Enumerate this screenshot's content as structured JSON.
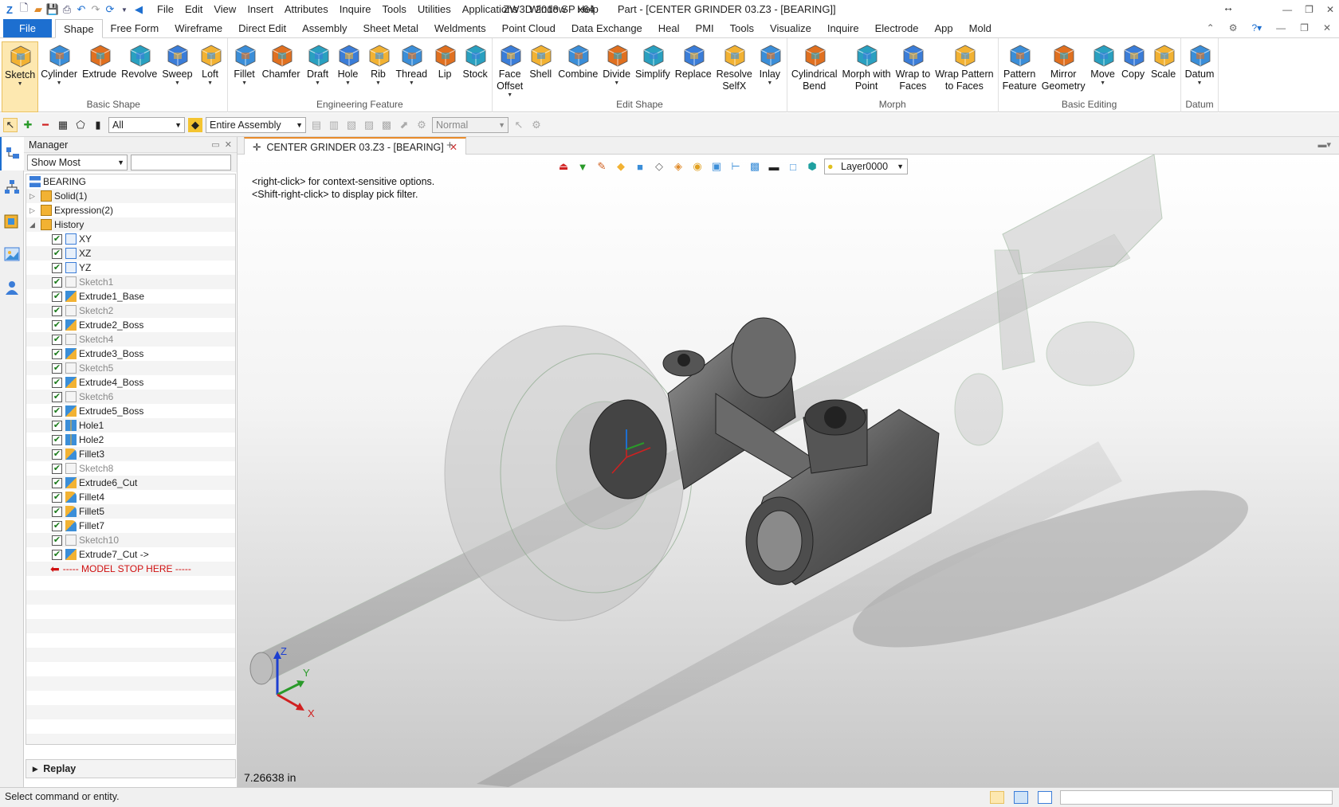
{
  "app": {
    "title": "ZW3D 2018 SP x64",
    "document_title": "Part - [CENTER GRINDER 03.Z3 - [BEARING]]"
  },
  "menubar": [
    "File",
    "Edit",
    "View",
    "Insert",
    "Attributes",
    "Inquire",
    "Tools",
    "Utilities",
    "Applications",
    "Window",
    "Help"
  ],
  "ribbon_tabs": [
    "File",
    "Shape",
    "Free Form",
    "Wireframe",
    "Direct Edit",
    "Assembly",
    "Sheet Metal",
    "Weldments",
    "Point Cloud",
    "Data Exchange",
    "Heal",
    "PMI",
    "Tools",
    "Visualize",
    "Inquire",
    "Electrode",
    "App",
    "Mold"
  ],
  "active_tab": "Shape",
  "ribbon_groups": [
    {
      "label": "Basic Shape",
      "buttons": [
        {
          "label": "Sketch",
          "icon": "sketch-icon",
          "dropdown": true,
          "selected": true
        },
        {
          "label": "Cylinder",
          "icon": "cylinder-icon",
          "dropdown": true
        },
        {
          "label": "Extrude",
          "icon": "extrude-icon"
        },
        {
          "label": "Revolve",
          "icon": "revolve-icon"
        },
        {
          "label": "Sweep",
          "icon": "sweep-icon",
          "dropdown": true
        },
        {
          "label": "Loft",
          "icon": "loft-icon",
          "dropdown": true
        }
      ]
    },
    {
      "label": "Engineering Feature",
      "buttons": [
        {
          "label": "Fillet",
          "icon": "fillet-icon",
          "dropdown": true
        },
        {
          "label": "Chamfer",
          "icon": "chamfer-icon"
        },
        {
          "label": "Draft",
          "icon": "draft-icon",
          "dropdown": true
        },
        {
          "label": "Hole",
          "icon": "hole-icon",
          "dropdown": true
        },
        {
          "label": "Rib",
          "icon": "rib-icon",
          "dropdown": true
        },
        {
          "label": "Thread",
          "icon": "thread-icon",
          "dropdown": true
        },
        {
          "label": "Lip",
          "icon": "lip-icon"
        },
        {
          "label": "Stock",
          "icon": "stock-icon"
        }
      ]
    },
    {
      "label": "Edit Shape",
      "buttons": [
        {
          "label": "Face\nOffset",
          "icon": "face-offset-icon",
          "dropdown": true
        },
        {
          "label": "Shell",
          "icon": "shell-icon"
        },
        {
          "label": "Combine",
          "icon": "combine-icon"
        },
        {
          "label": "Divide",
          "icon": "divide-icon",
          "dropdown": true
        },
        {
          "label": "Simplify",
          "icon": "simplify-icon"
        },
        {
          "label": "Replace",
          "icon": "replace-icon"
        },
        {
          "label": "Resolve\nSelfX",
          "icon": "resolve-selfx-icon"
        },
        {
          "label": "Inlay",
          "icon": "inlay-icon",
          "dropdown": true
        }
      ]
    },
    {
      "label": "Morph",
      "buttons": [
        {
          "label": "Cylindrical\nBend",
          "icon": "cylindrical-bend-icon"
        },
        {
          "label": "Morph with\nPoint",
          "icon": "morph-point-icon"
        },
        {
          "label": "Wrap to\nFaces",
          "icon": "wrap-faces-icon"
        },
        {
          "label": "Wrap Pattern\nto Faces",
          "icon": "wrap-pattern-icon"
        }
      ]
    },
    {
      "label": "Basic Editing",
      "buttons": [
        {
          "label": "Pattern\nFeature",
          "icon": "pattern-feature-icon"
        },
        {
          "label": "Mirror\nGeometry",
          "icon": "mirror-geometry-icon"
        },
        {
          "label": "Move",
          "icon": "move-icon",
          "dropdown": true
        },
        {
          "label": "Copy",
          "icon": "copy-icon"
        },
        {
          "label": "Scale",
          "icon": "scale-icon"
        }
      ]
    },
    {
      "label": "Datum",
      "buttons": [
        {
          "label": "Datum",
          "icon": "datum-icon",
          "dropdown": true
        }
      ]
    }
  ],
  "toolbar": {
    "filter_value": "All",
    "scope_value": "Entire Assembly",
    "mode_value": "Normal"
  },
  "manager": {
    "title": "Manager",
    "show_filter": "Show Most",
    "root": "BEARING",
    "folders": [
      "Solid(1)",
      "Expression(2)",
      "History"
    ],
    "history": [
      {
        "name": "XY",
        "kind": "plane",
        "suppressed": false
      },
      {
        "name": "XZ",
        "kind": "plane",
        "suppressed": false
      },
      {
        "name": "YZ",
        "kind": "plane",
        "suppressed": false
      },
      {
        "name": "Sketch1",
        "kind": "sketch",
        "suppressed": true
      },
      {
        "name": "Extrude1_Base",
        "kind": "feature",
        "suppressed": false
      },
      {
        "name": "Sketch2",
        "kind": "sketch",
        "suppressed": true
      },
      {
        "name": "Extrude2_Boss",
        "kind": "feature",
        "suppressed": false
      },
      {
        "name": "Sketch4",
        "kind": "sketch",
        "suppressed": true
      },
      {
        "name": "Extrude3_Boss",
        "kind": "feature",
        "suppressed": false
      },
      {
        "name": "Sketch5",
        "kind": "sketch",
        "suppressed": true
      },
      {
        "name": "Extrude4_Boss",
        "kind": "feature",
        "suppressed": false
      },
      {
        "name": "Sketch6",
        "kind": "sketch",
        "suppressed": true
      },
      {
        "name": "Extrude5_Boss",
        "kind": "feature",
        "suppressed": false
      },
      {
        "name": "Hole1",
        "kind": "hole",
        "suppressed": false
      },
      {
        "name": "Hole2",
        "kind": "hole",
        "suppressed": false
      },
      {
        "name": "Fillet3",
        "kind": "fillet",
        "suppressed": false
      },
      {
        "name": "Sketch8",
        "kind": "sketch",
        "suppressed": true
      },
      {
        "name": "Extrude6_Cut",
        "kind": "feature",
        "suppressed": false
      },
      {
        "name": "Fillet4",
        "kind": "fillet",
        "suppressed": false
      },
      {
        "name": "Fillet5",
        "kind": "fillet",
        "suppressed": false
      },
      {
        "name": "Fillet7",
        "kind": "fillet",
        "suppressed": false
      },
      {
        "name": "Sketch10",
        "kind": "sketch",
        "suppressed": true
      },
      {
        "name": "Extrude7_Cut ->",
        "kind": "feature",
        "suppressed": false
      }
    ],
    "stop_marker": "----- MODEL STOP HERE -----",
    "replay_label": "Replay"
  },
  "document_tab": "CENTER GRINDER 03.Z3 - [BEARING]",
  "viewport": {
    "hint_lines": [
      "<right-click> for context-sensitive options.",
      "<Shift-right-click> to display pick filter."
    ],
    "layer": "Layer0000",
    "distance_readout": "7.26638 in",
    "triad_labels": {
      "x": "X",
      "y": "Y",
      "z": "Z"
    }
  },
  "status_message": "Select command or entity.",
  "colors": {
    "accent": "#1d6fd0",
    "stop": "#d01010",
    "check": "#1a7a1a"
  }
}
